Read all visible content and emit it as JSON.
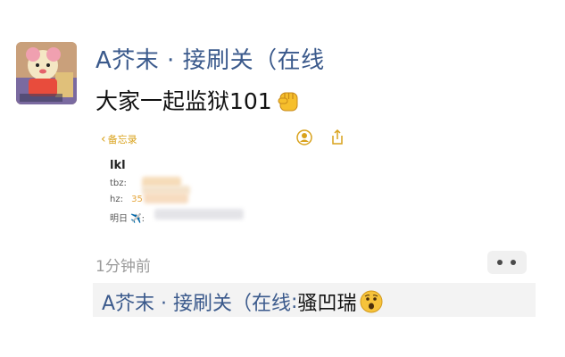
{
  "post": {
    "author": "A芥末 · 接刷关（在线",
    "message": "大家一起监狱101",
    "message_emoji": "raised-fist-emoji"
  },
  "attachment": {
    "back_label": "备忘录",
    "note_title": "lkl",
    "lines": [
      {
        "label": "tbz:"
      },
      {
        "label": "hz:",
        "partial": "35"
      },
      {
        "label": "明日 ✈️:"
      }
    ]
  },
  "timestamp": "1分钟前",
  "quote": {
    "author": "A芥末 · 接刷关（在线",
    "separator": ": ",
    "text": "骚凹瑞",
    "emoji": "hushed-face-emoji"
  },
  "colors": {
    "author": "#3b5a8c",
    "accent_yellow": "#d9a21c",
    "timestamp": "#9a9a9a",
    "quote_bg": "#f3f3f3"
  }
}
